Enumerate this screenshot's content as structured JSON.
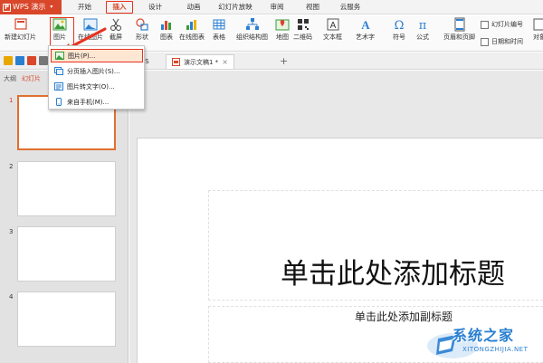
{
  "app": {
    "name": "WPS 演示",
    "logo_mark": "P",
    "brand_color": "#d9472b",
    "highlight_color": "#e8321f"
  },
  "menu": {
    "tabs": [
      "开始",
      "插入",
      "设计",
      "动画",
      "幻灯片放映",
      "审阅",
      "视图",
      "云服务"
    ],
    "active_tab": "插入"
  },
  "ribbon": {
    "new_slide": "新建幻灯片",
    "picture": "图片",
    "online_picture": "在线图片",
    "screenshot": "截屏",
    "shape": "形状",
    "chart": "图表",
    "online_chart": "在线图表",
    "table": "表格",
    "smartart": "组织结构图",
    "map": "地图",
    "qrcode": "二维码",
    "textbox": "文本框",
    "wordart": "艺术字",
    "symbol": "符号",
    "formula": "公式",
    "header_footer": "页眉和页脚",
    "slide_number": "幻灯片编号",
    "datetime": "日期和时间",
    "object": "对象"
  },
  "doc_tabs": {
    "partial_label": "PS",
    "active_label": "演示文稿1 *",
    "close": "×",
    "new": "+"
  },
  "left_panel": {
    "tabs": [
      "大纲",
      "幻灯片"
    ],
    "active_tab": "幻灯片",
    "slide_numbers": [
      "1",
      "2",
      "3",
      "4"
    ]
  },
  "dropdown": {
    "items": [
      {
        "label": "图片(P)...",
        "icon": "picture-icon",
        "highlighted": true
      },
      {
        "label": "分页插入图片(S)...",
        "icon": "pages-icon",
        "highlighted": false
      },
      {
        "label": "图片转文字(O)...",
        "icon": "ocr-icon",
        "highlighted": false
      },
      {
        "label": "来自手机(M)...",
        "icon": "phone-icon",
        "highlighted": false
      }
    ]
  },
  "slide": {
    "title": "单击此处添加标题",
    "subtitle": "单击此处添加副标题"
  },
  "watermark": {
    "text": "系统之家",
    "url": "XITONGZHIJIA.NET"
  }
}
